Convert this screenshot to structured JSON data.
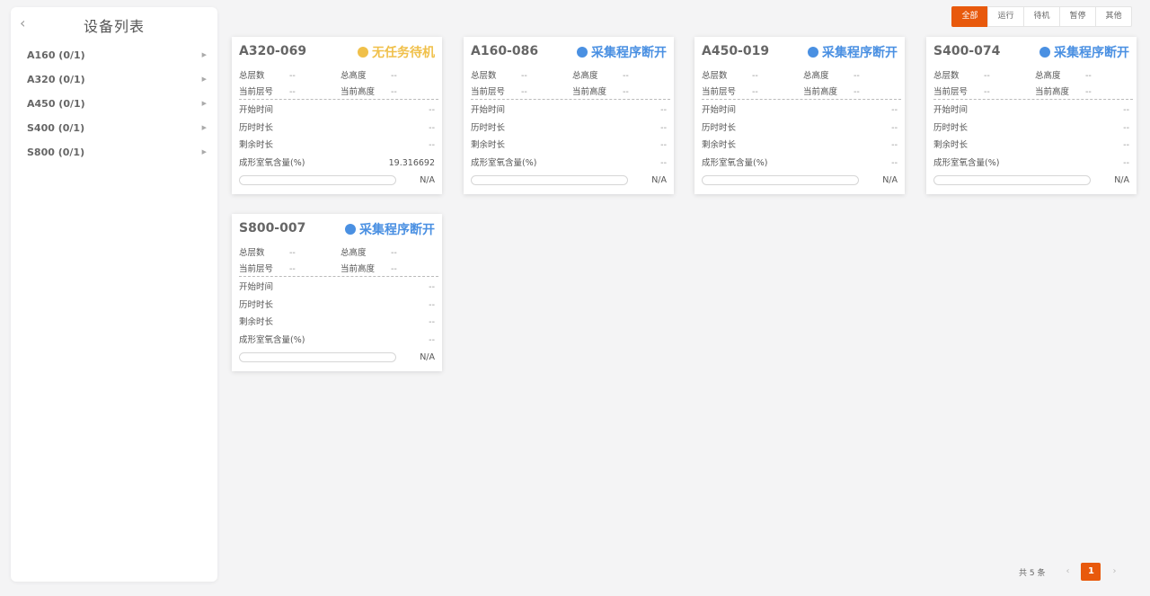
{
  "sidebar": {
    "title": "设备列表",
    "items": [
      {
        "label": "A160 (0/1)"
      },
      {
        "label": "A320 (0/1)"
      },
      {
        "label": "A450 (0/1)"
      },
      {
        "label": "S400 (0/1)"
      },
      {
        "label": "S800 (0/1)"
      }
    ]
  },
  "filters": [
    "全部",
    "运行",
    "待机",
    "暂停",
    "其他"
  ],
  "active_filter": "全部",
  "labels": {
    "total_layers": "总层数",
    "total_height": "总高度",
    "current_layer": "当前层号",
    "current_height": "当前高度",
    "start_time": "开始时间",
    "elapsed": "历时时长",
    "remaining": "剩余时长",
    "oxygen": "成形室氧含量(%)"
  },
  "cards": [
    {
      "name": "A320-069",
      "status": "无任务待机",
      "status_color": "#f0c04a",
      "total_layers": "--",
      "total_height": "--",
      "current_layer": "--",
      "current_height": "--",
      "start_time": "--",
      "elapsed": "--",
      "remaining": "--",
      "oxygen": "19.316692",
      "progress_text": "N/A"
    },
    {
      "name": "A160-086",
      "status": "采集程序断开",
      "status_color": "#4a90e2",
      "total_layers": "--",
      "total_height": "--",
      "current_layer": "--",
      "current_height": "--",
      "start_time": "--",
      "elapsed": "--",
      "remaining": "--",
      "oxygen": "--",
      "progress_text": "N/A"
    },
    {
      "name": "A450-019",
      "status": "采集程序断开",
      "status_color": "#4a90e2",
      "total_layers": "--",
      "total_height": "--",
      "current_layer": "--",
      "current_height": "--",
      "start_time": "--",
      "elapsed": "--",
      "remaining": "--",
      "oxygen": "--",
      "progress_text": "N/A"
    },
    {
      "name": "S400-074",
      "status": "采集程序断开",
      "status_color": "#4a90e2",
      "total_layers": "--",
      "total_height": "--",
      "current_layer": "--",
      "current_height": "--",
      "start_time": "--",
      "elapsed": "--",
      "remaining": "--",
      "oxygen": "--",
      "progress_text": "N/A"
    },
    {
      "name": "S800-007",
      "status": "采集程序断开",
      "status_color": "#4a90e2",
      "total_layers": "--",
      "total_height": "--",
      "current_layer": "--",
      "current_height": "--",
      "start_time": "--",
      "elapsed": "--",
      "remaining": "--",
      "oxygen": "--",
      "progress_text": "N/A"
    }
  ],
  "pagination": {
    "total": "共 5 条",
    "current_page": "1",
    "prev": "‹",
    "next": "›"
  },
  "colors": {
    "accent": "#e8590c",
    "status_idle": "#f0c04a",
    "status_disconnected": "#4a90e2"
  }
}
